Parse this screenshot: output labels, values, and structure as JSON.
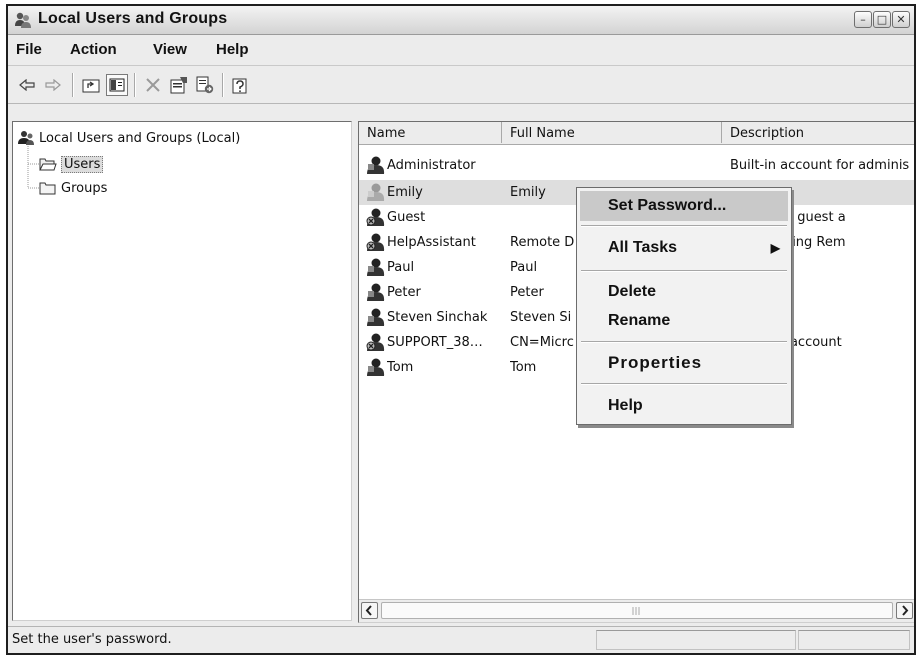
{
  "window": {
    "title": "Local Users and Groups"
  },
  "title_buttons": {
    "minimize": "–",
    "maximize": "□",
    "close": "✕"
  },
  "menubar": {
    "items": [
      "File",
      "Action",
      "View",
      "Help"
    ]
  },
  "toolbar": {
    "buttons": [
      "back-icon",
      "forward-icon",
      "up-folder-icon",
      "show-hide-tree-icon",
      "delete-icon",
      "properties-icon",
      "export-list-icon",
      "help-icon"
    ]
  },
  "tree": {
    "root": "Local Users and Groups (Local)",
    "children": [
      "Users",
      "Groups"
    ],
    "selected": "Users"
  },
  "list": {
    "columns": [
      "Name",
      "Full Name",
      "Description"
    ],
    "rows": [
      {
        "name": "Administrator",
        "full_name": "",
        "description": "Built-in account for adminis"
      },
      {
        "name": "Emily",
        "full_name": "Emily",
        "description": ""
      },
      {
        "name": "Guest",
        "full_name": "",
        "description": ":count for guest a"
      },
      {
        "name": "HelpAssistant",
        "full_name": "Remote D",
        "description": "for Providing Rem"
      },
      {
        "name": "Paul",
        "full_name": "Paul",
        "description": ""
      },
      {
        "name": "Peter",
        "full_name": "Peter",
        "description": ""
      },
      {
        "name": "Steven Sinchak",
        "full_name": "Steven Si",
        "description": ""
      },
      {
        "name": "SUPPORT_38…",
        "full_name": "CN=Micrc",
        "description": "vendor's account"
      },
      {
        "name": "Tom",
        "full_name": "Tom",
        "description": ""
      }
    ],
    "selected_row": "Emily"
  },
  "context_menu": {
    "items": [
      "Set Password...",
      "All Tasks",
      "Delete",
      "Rename",
      "Properties",
      "Help"
    ],
    "highlighted": "Set Password..."
  },
  "statusbar": {
    "text": "Set the user's password."
  }
}
